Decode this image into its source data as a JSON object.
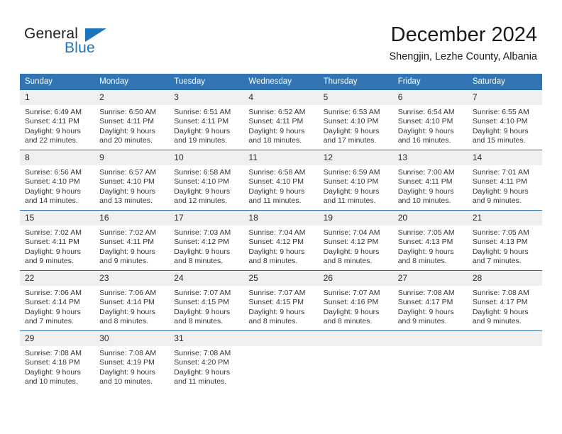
{
  "brand": {
    "name_top": "General",
    "name_bottom": "Blue",
    "triangle_color": "#1b75bb",
    "text_color": "#231f20"
  },
  "header": {
    "title": "December 2024",
    "subtitle": "Shengjin, Lezhe County, Albania"
  },
  "theme": {
    "header_blue": "#3175b5",
    "row_divider_blue": "#2b6ca8",
    "daynum_band": "#efefef"
  },
  "weekday_headers": [
    "Sunday",
    "Monday",
    "Tuesday",
    "Wednesday",
    "Thursday",
    "Friday",
    "Saturday"
  ],
  "weeks": [
    {
      "days": [
        {
          "date": "1",
          "sunrise": "Sunrise: 6:49 AM",
          "sunset": "Sunset: 4:11 PM",
          "daylight_1": "Daylight: 9 hours",
          "daylight_2": "and 22 minutes."
        },
        {
          "date": "2",
          "sunrise": "Sunrise: 6:50 AM",
          "sunset": "Sunset: 4:11 PM",
          "daylight_1": "Daylight: 9 hours",
          "daylight_2": "and 20 minutes."
        },
        {
          "date": "3",
          "sunrise": "Sunrise: 6:51 AM",
          "sunset": "Sunset: 4:11 PM",
          "daylight_1": "Daylight: 9 hours",
          "daylight_2": "and 19 minutes."
        },
        {
          "date": "4",
          "sunrise": "Sunrise: 6:52 AM",
          "sunset": "Sunset: 4:11 PM",
          "daylight_1": "Daylight: 9 hours",
          "daylight_2": "and 18 minutes."
        },
        {
          "date": "5",
          "sunrise": "Sunrise: 6:53 AM",
          "sunset": "Sunset: 4:10 PM",
          "daylight_1": "Daylight: 9 hours",
          "daylight_2": "and 17 minutes."
        },
        {
          "date": "6",
          "sunrise": "Sunrise: 6:54 AM",
          "sunset": "Sunset: 4:10 PM",
          "daylight_1": "Daylight: 9 hours",
          "daylight_2": "and 16 minutes."
        },
        {
          "date": "7",
          "sunrise": "Sunrise: 6:55 AM",
          "sunset": "Sunset: 4:10 PM",
          "daylight_1": "Daylight: 9 hours",
          "daylight_2": "and 15 minutes."
        }
      ]
    },
    {
      "days": [
        {
          "date": "8",
          "sunrise": "Sunrise: 6:56 AM",
          "sunset": "Sunset: 4:10 PM",
          "daylight_1": "Daylight: 9 hours",
          "daylight_2": "and 14 minutes."
        },
        {
          "date": "9",
          "sunrise": "Sunrise: 6:57 AM",
          "sunset": "Sunset: 4:10 PM",
          "daylight_1": "Daylight: 9 hours",
          "daylight_2": "and 13 minutes."
        },
        {
          "date": "10",
          "sunrise": "Sunrise: 6:58 AM",
          "sunset": "Sunset: 4:10 PM",
          "daylight_1": "Daylight: 9 hours",
          "daylight_2": "and 12 minutes."
        },
        {
          "date": "11",
          "sunrise": "Sunrise: 6:58 AM",
          "sunset": "Sunset: 4:10 PM",
          "daylight_1": "Daylight: 9 hours",
          "daylight_2": "and 11 minutes."
        },
        {
          "date": "12",
          "sunrise": "Sunrise: 6:59 AM",
          "sunset": "Sunset: 4:10 PM",
          "daylight_1": "Daylight: 9 hours",
          "daylight_2": "and 11 minutes."
        },
        {
          "date": "13",
          "sunrise": "Sunrise: 7:00 AM",
          "sunset": "Sunset: 4:11 PM",
          "daylight_1": "Daylight: 9 hours",
          "daylight_2": "and 10 minutes."
        },
        {
          "date": "14",
          "sunrise": "Sunrise: 7:01 AM",
          "sunset": "Sunset: 4:11 PM",
          "daylight_1": "Daylight: 9 hours",
          "daylight_2": "and 9 minutes."
        }
      ]
    },
    {
      "days": [
        {
          "date": "15",
          "sunrise": "Sunrise: 7:02 AM",
          "sunset": "Sunset: 4:11 PM",
          "daylight_1": "Daylight: 9 hours",
          "daylight_2": "and 9 minutes."
        },
        {
          "date": "16",
          "sunrise": "Sunrise: 7:02 AM",
          "sunset": "Sunset: 4:11 PM",
          "daylight_1": "Daylight: 9 hours",
          "daylight_2": "and 9 minutes."
        },
        {
          "date": "17",
          "sunrise": "Sunrise: 7:03 AM",
          "sunset": "Sunset: 4:12 PM",
          "daylight_1": "Daylight: 9 hours",
          "daylight_2": "and 8 minutes."
        },
        {
          "date": "18",
          "sunrise": "Sunrise: 7:04 AM",
          "sunset": "Sunset: 4:12 PM",
          "daylight_1": "Daylight: 9 hours",
          "daylight_2": "and 8 minutes."
        },
        {
          "date": "19",
          "sunrise": "Sunrise: 7:04 AM",
          "sunset": "Sunset: 4:12 PM",
          "daylight_1": "Daylight: 9 hours",
          "daylight_2": "and 8 minutes."
        },
        {
          "date": "20",
          "sunrise": "Sunrise: 7:05 AM",
          "sunset": "Sunset: 4:13 PM",
          "daylight_1": "Daylight: 9 hours",
          "daylight_2": "and 8 minutes."
        },
        {
          "date": "21",
          "sunrise": "Sunrise: 7:05 AM",
          "sunset": "Sunset: 4:13 PM",
          "daylight_1": "Daylight: 9 hours",
          "daylight_2": "and 7 minutes."
        }
      ]
    },
    {
      "days": [
        {
          "date": "22",
          "sunrise": "Sunrise: 7:06 AM",
          "sunset": "Sunset: 4:14 PM",
          "daylight_1": "Daylight: 9 hours",
          "daylight_2": "and 7 minutes."
        },
        {
          "date": "23",
          "sunrise": "Sunrise: 7:06 AM",
          "sunset": "Sunset: 4:14 PM",
          "daylight_1": "Daylight: 9 hours",
          "daylight_2": "and 8 minutes."
        },
        {
          "date": "24",
          "sunrise": "Sunrise: 7:07 AM",
          "sunset": "Sunset: 4:15 PM",
          "daylight_1": "Daylight: 9 hours",
          "daylight_2": "and 8 minutes."
        },
        {
          "date": "25",
          "sunrise": "Sunrise: 7:07 AM",
          "sunset": "Sunset: 4:15 PM",
          "daylight_1": "Daylight: 9 hours",
          "daylight_2": "and 8 minutes."
        },
        {
          "date": "26",
          "sunrise": "Sunrise: 7:07 AM",
          "sunset": "Sunset: 4:16 PM",
          "daylight_1": "Daylight: 9 hours",
          "daylight_2": "and 8 minutes."
        },
        {
          "date": "27",
          "sunrise": "Sunrise: 7:08 AM",
          "sunset": "Sunset: 4:17 PM",
          "daylight_1": "Daylight: 9 hours",
          "daylight_2": "and 9 minutes."
        },
        {
          "date": "28",
          "sunrise": "Sunrise: 7:08 AM",
          "sunset": "Sunset: 4:17 PM",
          "daylight_1": "Daylight: 9 hours",
          "daylight_2": "and 9 minutes."
        }
      ]
    },
    {
      "days": [
        {
          "date": "29",
          "sunrise": "Sunrise: 7:08 AM",
          "sunset": "Sunset: 4:18 PM",
          "daylight_1": "Daylight: 9 hours",
          "daylight_2": "and 10 minutes."
        },
        {
          "date": "30",
          "sunrise": "Sunrise: 7:08 AM",
          "sunset": "Sunset: 4:19 PM",
          "daylight_1": "Daylight: 9 hours",
          "daylight_2": "and 10 minutes."
        },
        {
          "date": "31",
          "sunrise": "Sunrise: 7:08 AM",
          "sunset": "Sunset: 4:20 PM",
          "daylight_1": "Daylight: 9 hours",
          "daylight_2": "and 11 minutes."
        },
        {
          "date": "",
          "sunrise": "",
          "sunset": "",
          "daylight_1": "",
          "daylight_2": ""
        },
        {
          "date": "",
          "sunrise": "",
          "sunset": "",
          "daylight_1": "",
          "daylight_2": ""
        },
        {
          "date": "",
          "sunrise": "",
          "sunset": "",
          "daylight_1": "",
          "daylight_2": ""
        },
        {
          "date": "",
          "sunrise": "",
          "sunset": "",
          "daylight_1": "",
          "daylight_2": ""
        }
      ]
    }
  ]
}
